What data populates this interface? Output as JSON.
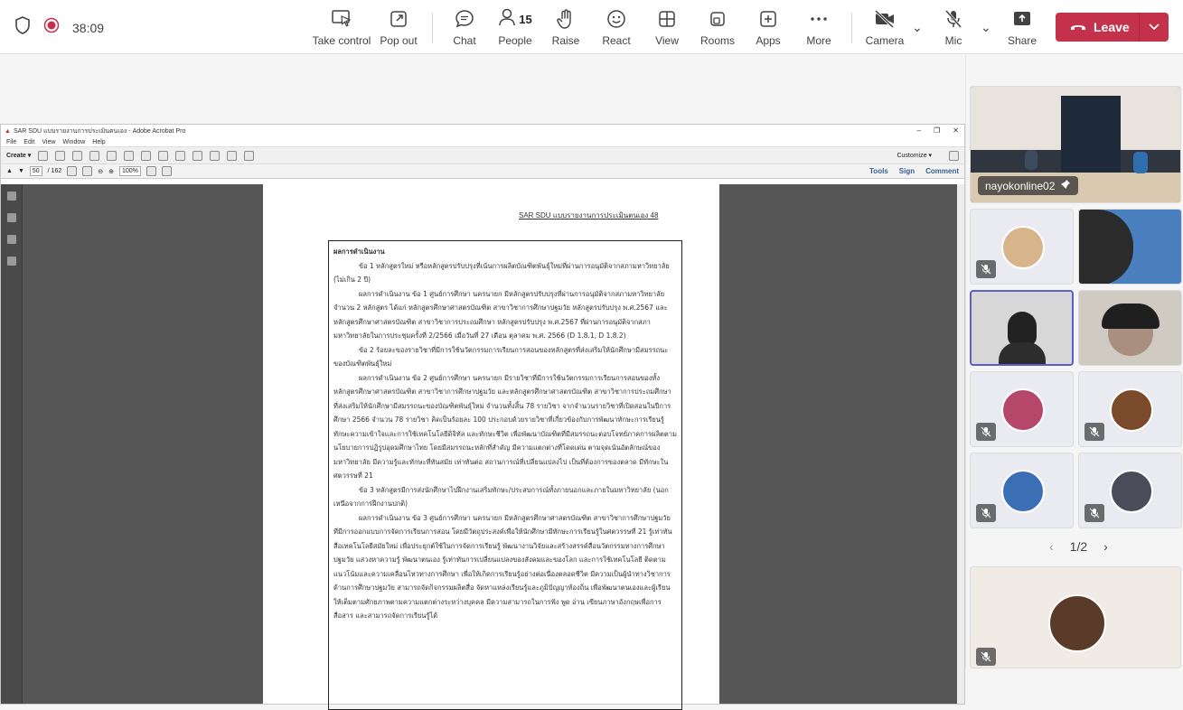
{
  "topbar": {
    "timer": "38:09",
    "buttons": [
      {
        "label": "Take control",
        "icon": "take-control-icon"
      },
      {
        "label": "Pop out",
        "icon": "pop-out-icon"
      },
      {
        "label": "Chat",
        "icon": "chat-icon"
      },
      {
        "label": "People",
        "icon": "people-icon",
        "count": "15"
      },
      {
        "label": "Raise",
        "icon": "raise-hand-icon"
      },
      {
        "label": "React",
        "icon": "react-icon"
      },
      {
        "label": "View",
        "icon": "view-icon"
      },
      {
        "label": "Rooms",
        "icon": "rooms-icon"
      },
      {
        "label": "Apps",
        "icon": "apps-icon"
      },
      {
        "label": "More",
        "icon": "more-icon"
      },
      {
        "label": "Camera",
        "icon": "camera-off-icon"
      },
      {
        "label": "Mic",
        "icon": "mic-off-icon"
      },
      {
        "label": "Share",
        "icon": "share-icon"
      }
    ],
    "leave_label": "Leave",
    "leave_color": "#c4314b"
  },
  "acrobat": {
    "title": "SAR SDU แบบรายงานการประเมินตนเอง - Adobe Acrobat Pro",
    "menu": [
      "File",
      "Edit",
      "View",
      "Window",
      "Help"
    ],
    "create_label": "Create",
    "customize_label": "Customize",
    "page_current": "50",
    "page_total": "/ 162",
    "zoom": "100%",
    "right_links": [
      "Tools",
      "Sign",
      "Comment"
    ]
  },
  "document": {
    "header": "SAR SDU แบบรายงานการประเมินตนเอง     48",
    "heading": "ผลการดำเนินงาน",
    "paragraphs": [
      "ข้อ 1 หลักสูตรใหม่ หรือหลักสูตรปรับปรุงที่เน้นการผลิตบัณฑิตพันธุ์ใหม่ที่ผ่านการอนุมัติจากสภามหาวิทยาลัย (ไม่เกิน 2 ปี)",
      "ผลการดำเนินงาน ข้อ 1 ศูนย์การศึกษา นครนายก มีหลักสูตรปรับปรุงที่ผ่านการอนุมัติจากสภามหาวิทยาลัย จำนวน 2 หลักสูตร ได้แก่ หลักสูตรศึกษาศาสตรบัณฑิต สาขาวิชาการศึกษาปฐมวัย หลักสูตรปรับปรุง พ.ศ.2567 และหลักสูตรศึกษาศาสตรบัณฑิต สาขาวิชาการประถมศึกษา หลักสูตรปรับปรุง พ.ศ.2567 ที่ผ่านการอนุมัติจากสภามหาวิทยาลัยในการประชุมครั้งที่ 2/2566 เมื่อวันที่ 27 เดือน ตุลาคม พ.ศ. 2566 (D 1.8.1, D 1.8.2)",
      "ข้อ 2 ร้อยละของรายวิชาที่มีการใช้นวัตกรรมการเรียนการสอนของหลักสูตรที่ส่งเสริมให้นักศึกษามีสมรรถนะของบัณฑิตพันธุ์ใหม่",
      "ผลการดำเนินงาน ข้อ 2 ศูนย์การศึกษา นครนายก มีรายวิชาที่มีการใช้นวัตกรรมการเรียนการสอนของทั้งหลักสูตรศึกษาศาสตรบัณฑิต สาขาวิชาการศึกษาปฐมวัย และหลักสูตรศึกษาศาสตรบัณฑิต สาขาวิชาการประถมศึกษา ที่ส่งเสริมให้นักศึกษามีสมรรถนะของบัณฑิตพันธุ์ใหม่ จำนวนทั้งสิ้น 78 รายวิชา จากจำนวนรายวิชาที่เปิดสอนในปีการศึกษา 2566 จำนวน 78 รายวิชา คิดเป็นร้อยละ 100 ประกอบด้วยรายวิชาที่เกี่ยวข้องกับการพัฒนาทักษะการเรียนรู้ ทักษะความเข้าใจและการใช้เทคโนโลยีดิจิทัล และทักษะชีวิต เพื่อพัฒนาบัณฑิตที่มีสมรรถนะตอบโจทย์ภาคการผลิตตามนโยบายการปฏิรูปอุดมศึกษาไทย โดยมีสมรรถนะหลักที่สำคัญ มีความแตกต่างที่โดดเด่น ตามจุดเน้นอัตลักษณ์ของมหาวิทยาลัย มีความรู้และทักษะที่ทันสมัย เท่าทันต่อ สถานการณ์ที่เปลี่ยนแปลงไป เป็นที่ต้องการของตลาด มีทักษะในศตวรรษที่ 21",
      "ข้อ 3 หลักสูตรมีการส่งนักศึกษาไปฝึกงานเสริมทักษะ/ประสบการณ์ทั้งภายนอกและภายในมหาวิทยาลัย (นอกเหนือจากการฝึกงานปกติ)",
      "ผลการดำเนินงาน ข้อ 3 ศูนย์การศึกษา นครนายก มีหลักสูตรศึกษาศาสตรบัณฑิต สาขาวิชาการศึกษาปฐมวัย ที่มีการออกแบบการจัดการเรียนการสอน โดยมีวัตถุประสงค์เพื่อให้นักศึกษามีทักษะการเรียนรู้ในศตวรรษที่ 21 รู้เท่าทัน สื่อเทคโนโลยีสมัยใหม่ เพื่อประยุกต์ใช้ในการจัดการเรียนรู้ พัฒนางานวิจัยและสร้างสรรค์สื่อนวัตกรรมทางการศึกษาปฐมวัย แสวงหาความรู้ พัฒนาตนเอง รู้เท่าทันการเปลี่ยนแปลงของสังคมและของโลก และการใช้เทคโนโลยี ติดตามแนวโน้มและความเคลื่อนไหวทางการศึกษา เพื่อให้เกิดการเรียนรู้อย่างต่อเนื่องตลอดชีวิต มีความเป็นผู้นำทางวิชาการด้านการศึกษาปฐมวัย สามารถจัดกิจกรรมผลิตสื่อ จัดหาแหล่งเรียนรู้และภูมิปัญญาท้องถิ่น เพื่อพัฒนาตนเองและผู้เรียนให้เต็มตามศักยภาพตามความแตกต่างระหว่างบุคคล มีความสามารถในการฟัง พูด อ่าน เขียนภาษาอังกฤษเพื่อการสื่อสาร และสามารถจัดการเรียนรู้ได้"
    ]
  },
  "participants": {
    "featured_name": "nayokonline02",
    "pager": "1/2"
  }
}
